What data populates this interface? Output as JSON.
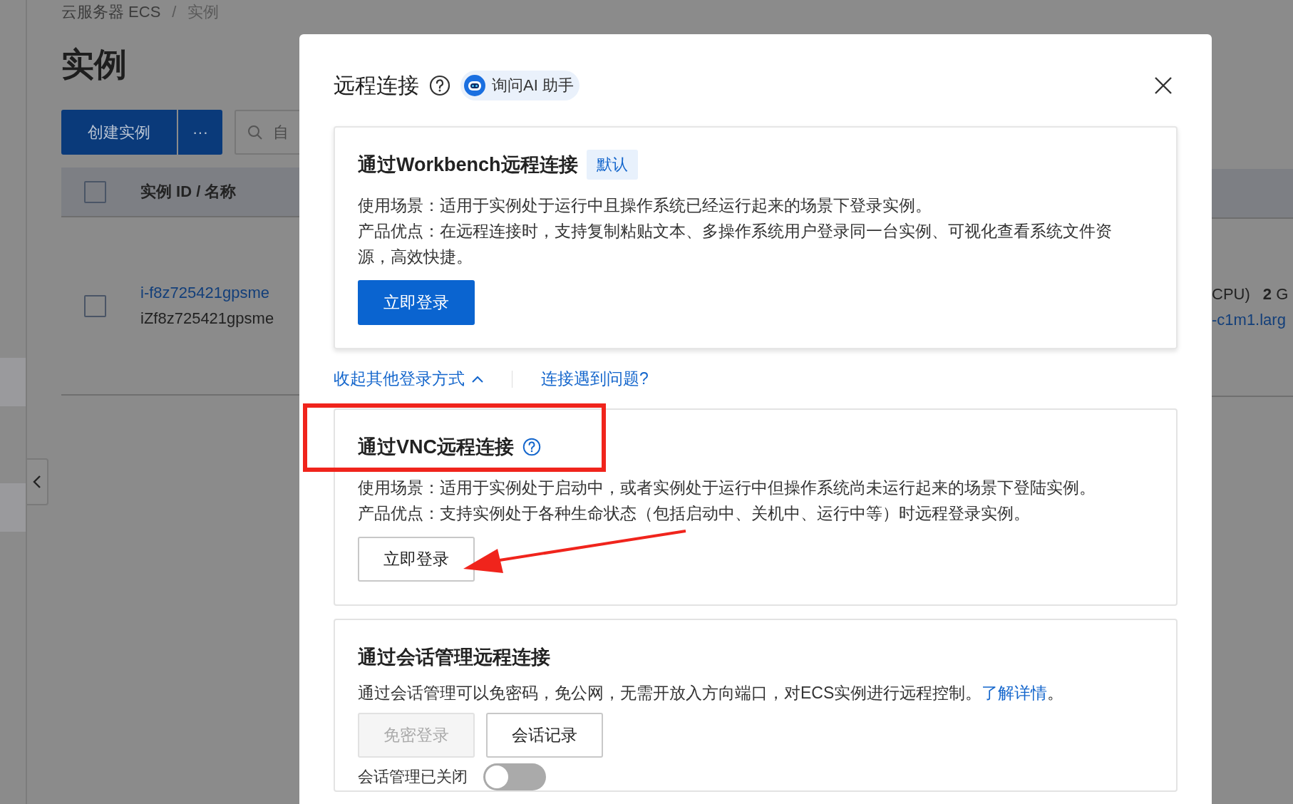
{
  "breadcrumb": {
    "items": [
      {
        "label": "云服务器 ECS"
      },
      {
        "label": "实例"
      }
    ],
    "separator": "/"
  },
  "page_title": "实例",
  "toolbar": {
    "create_button": "创建实例",
    "more_button": "···",
    "search": {
      "placeholder": "自"
    }
  },
  "table": {
    "header_checked": false,
    "columns": [
      "实例 ID / 名称"
    ],
    "rows": [
      {
        "checked": false,
        "instance_id": "i-f8z725421gpsme",
        "instance_name": "iZf8z725421gpsme",
        "column_3": "CPU)",
        "column_4": "**2** G",
        "column_5": "-c1m1.larg"
      }
    ]
  },
  "dialog": {
    "title": "远程连接",
    "assistant": "询问AI 助手",
    "sections": [
      {
        "kind": "featured",
        "title": "通过Workbench远程连接",
        "tag": "默认",
        "lines": [
          {
            "text": "使用场景：适用于实例处于运行中且操作系统已经运行起来的场景下登录实例。"
          },
          {
            "text": "产品优点：在远程连接时，支持复制粘贴文本、多操作系统用户登录同一台实例、可视化查看系统文件资源，高效快捷。"
          }
        ],
        "buttons": [
          {
            "label": "立即登录",
            "kind": "primary"
          }
        ]
      },
      {
        "kind": "plain",
        "title": "通过VNC远程连接",
        "help": true,
        "lines": [
          {
            "text": "使用场景：适用于实例处于启动中，或者实例处于运行中但操作系统尚未运行起来的场景下登陆实例。"
          },
          {
            "text": "产品优点：支持实例处于各种生命状态（包括启动中、关机中、运行中等）时远程登录实例。"
          }
        ],
        "buttons": [
          {
            "label": "立即登录",
            "kind": "default"
          }
        ]
      },
      {
        "kind": "compact",
        "title": "通过会话管理远程连接",
        "lines": [
          {
            "text": "通过会话管理可以免密码，免公网，无需开放入方向端口，对ECS实例进行远程控制。",
            "link": "了解详情",
            "after": "。"
          }
        ],
        "buttons": [
          {
            "label": "免密登录",
            "kind": "default",
            "disabled": true
          },
          {
            "label": "会话记录",
            "kind": "default",
            "disabled": false
          }
        ],
        "toggle": {
          "label": "会话管理已关闭",
          "on": false
        }
      }
    ],
    "links": {
      "collapse": "收起其他登录方式",
      "trouble": "连接遇到问题?"
    }
  }
}
